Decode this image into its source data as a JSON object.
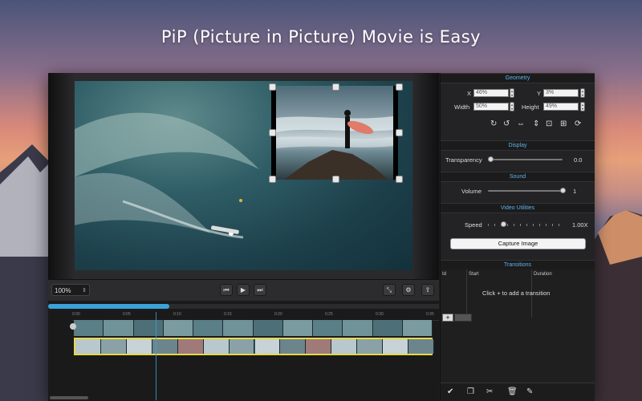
{
  "headline": "PiP (Picture in Picture) Movie is Easy",
  "player": {
    "zoom": "100%",
    "icons": [
      "prev-frame-icon",
      "play-icon",
      "next-frame-icon",
      "fullscreen-icon",
      "gear-icon",
      "share-icon"
    ]
  },
  "timeline": {
    "ticks": [
      "0:00",
      "0:05",
      "0:10",
      "0:15",
      "0:20",
      "0:25",
      "0:30",
      "0:35"
    ],
    "progress": 0.31
  },
  "inspector": {
    "geometry": {
      "title": "Geometry",
      "x_label": "X",
      "x_value": "46%",
      "y_label": "Y",
      "y_value": "3%",
      "width_label": "Width",
      "width_value": "50%",
      "height_label": "Height",
      "height_value": "49%"
    },
    "display": {
      "title": "Display",
      "transparency_label": "Transparency",
      "transparency_value": "0.0",
      "transparency_level": 0.0
    },
    "sound": {
      "title": "Sound",
      "volume_label": "Volume",
      "volume_value": "1",
      "volume_level": 1.0
    },
    "video_utilities": {
      "title": "Video Utilities",
      "speed_label": "Speed",
      "speed_value": "1.00X",
      "speed_level": 0.2,
      "capture_label": "Capture Image"
    },
    "transitions": {
      "title": "Transitions",
      "columns": [
        "Id",
        "Start",
        "Duration"
      ],
      "empty_message": "Click + to add a transition",
      "add_label": "+"
    }
  },
  "colors": {
    "accent": "#3aa2d8",
    "section_title": "#5fb3e8",
    "selected_track": "#e7d84a"
  }
}
